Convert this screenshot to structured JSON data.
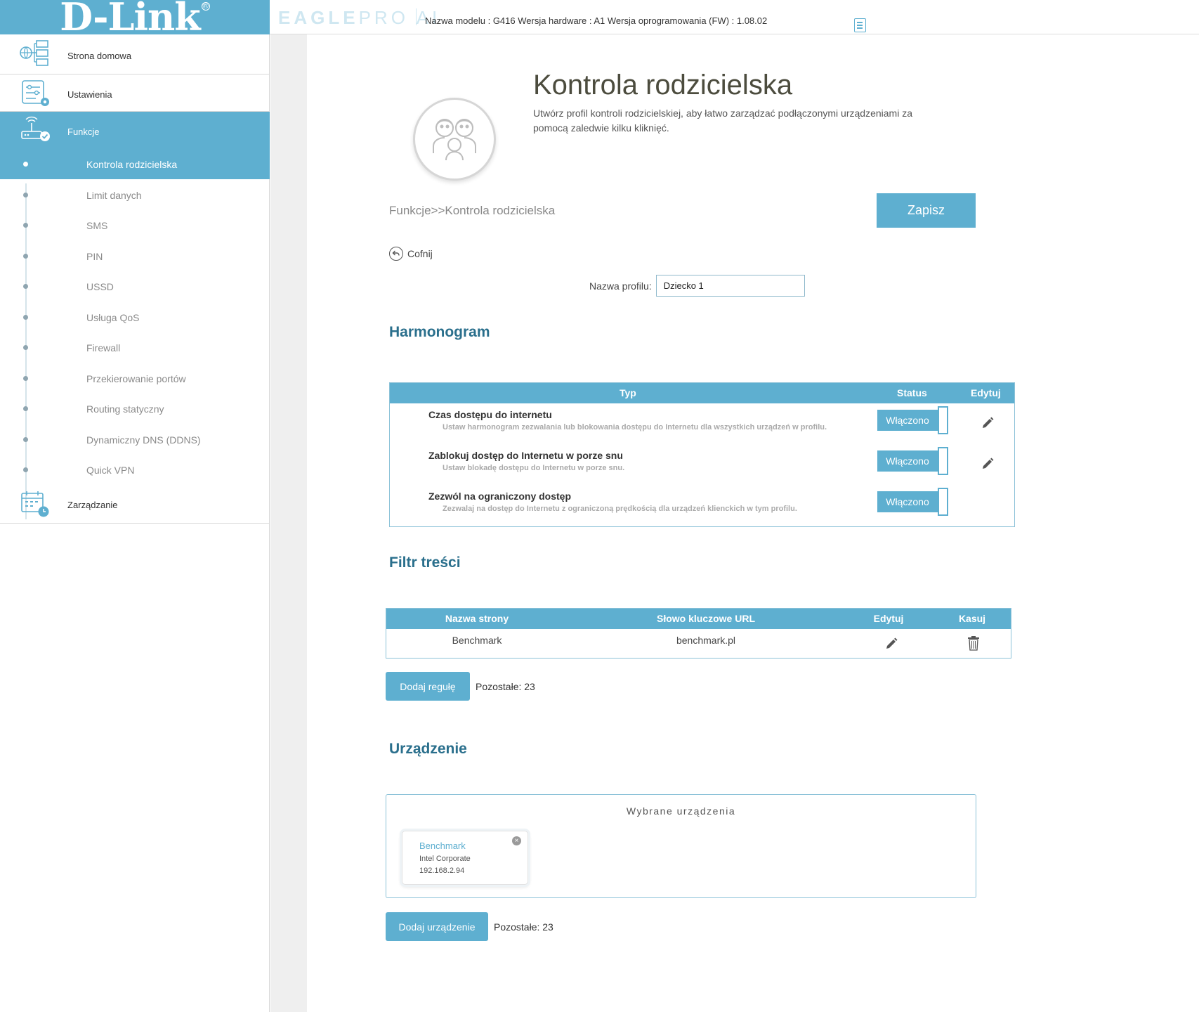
{
  "header": {
    "brand": "D-Link",
    "brand_mark": "®",
    "product_bold": "EAGLE",
    "product_light": "PRO AI",
    "model_info": "Nazwa modelu : G416 Wersja hardware : A1 Wersja oprogramowania (FW) : 1.08.02",
    "icons": [
      "notes-icon"
    ]
  },
  "sidebar": {
    "main": [
      {
        "label": "Strona domowa",
        "icon": "network-map-icon"
      },
      {
        "label": "Ustawienia",
        "icon": "settings-icon"
      },
      {
        "label": "Funkcje",
        "icon": "router-features-icon",
        "active": true
      },
      {
        "label": "Zarządzanie",
        "icon": "calendar-clock-icon"
      }
    ],
    "sub": [
      {
        "label": "Kontrola rodzicielska",
        "active": true
      },
      {
        "label": "Limit danych"
      },
      {
        "label": "SMS"
      },
      {
        "label": "PIN"
      },
      {
        "label": "USSD"
      },
      {
        "label": "Usługa QoS"
      },
      {
        "label": "Firewall"
      },
      {
        "label": "Przekierowanie portów"
      },
      {
        "label": "Routing statyczny"
      },
      {
        "label": "Dynamiczny DNS (DDNS)"
      },
      {
        "label": "Quick VPN"
      }
    ]
  },
  "page": {
    "title": "Kontrola rodzicielska",
    "description": "Utwórz profil kontroli rodzicielskiej, aby łatwo zarządzać podłączonymi urządzeniami za pomocą zaledwie kilku kliknięć.",
    "breadcrumb": "Funkcje>>Kontrola rodzicielska",
    "save_label": "Zapisz",
    "back_label": "Cofnij",
    "profile_label": "Nazwa profilu:",
    "profile_value": "Dziecko 1"
  },
  "schedule": {
    "title": "Harmonogram",
    "headers": {
      "type": "Typ",
      "status": "Status",
      "edit": "Edytuj"
    },
    "rows": [
      {
        "title": "Czas dostępu do internetu",
        "desc": "Ustaw harmonogram zezwalania lub blokowania dostępu do Internetu dla wszystkich urządzeń w profilu.",
        "status": "Włączono"
      },
      {
        "title": "Zablokuj dostęp do Internetu w porze snu",
        "desc": "Ustaw blokadę dostępu do Internetu w porze snu.",
        "status": "Włączono"
      },
      {
        "title": "Zezwól na ograniczony dostęp",
        "desc": "Zezwalaj na dostęp do Internetu z ograniczoną prędkością dla urządzeń klienckich w tym profilu.",
        "status": "Włączono"
      }
    ]
  },
  "content_filter": {
    "title": "Filtr treści",
    "headers": {
      "site": "Nazwa strony",
      "keyword": "Słowo kluczowe URL",
      "edit": "Edytuj",
      "delete": "Kasuj"
    },
    "rows": [
      {
        "site": "Benchmark",
        "keyword": "benchmark.pl"
      }
    ],
    "add_label": "Dodaj regułę",
    "remaining": "Pozostałe: 23"
  },
  "devices": {
    "title": "Urządzenie",
    "box_title": "Wybrane urządzenia",
    "items": [
      {
        "name": "Benchmark",
        "vendor": "Intel Corporate",
        "ip": "192.168.2.94"
      }
    ],
    "add_label": "Dodaj urządzenie",
    "remaining": "Pozostałe: 23"
  },
  "colors": {
    "accent": "#5eafd0",
    "section_title": "#2a6f8c"
  }
}
